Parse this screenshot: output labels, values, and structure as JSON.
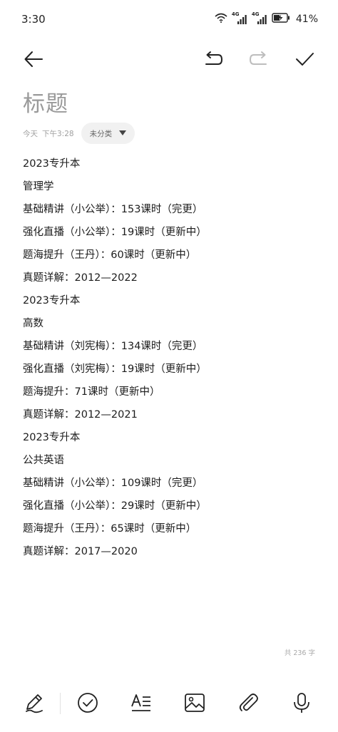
{
  "status_bar": {
    "time": "3:30",
    "network_1": "4G",
    "network_2": "4G",
    "battery_percent": "41%"
  },
  "toolbar": {
    "back_icon": "arrow-left",
    "undo_icon": "undo",
    "redo_icon": "redo",
    "done_icon": "checkmark"
  },
  "note": {
    "title_placeholder": "标题",
    "date_label": "今天",
    "time_label": "下午3:28",
    "category_label": "未分类",
    "lines": [
      "2023专升本",
      "管理学",
      "基础精讲（小公举）：153课时（完更）",
      "强化直播（小公举）：19课时（更新中）",
      "题海提升（王丹）：60课时（更新中）",
      "真题详解：2012—2022",
      "2023专升本",
      "高数",
      "基础精讲（刘宪梅）：134课时（完更）",
      "强化直播（刘宪梅）：19课时（更新中）",
      "题海提升：71课时（更新中）",
      "真题详解：2012—2021",
      "2023专升本",
      "公共英语",
      "基础精讲（小公举）：109课时（完更）",
      "强化直播（小公举）：29课时（更新中）",
      "题海提升（王丹）：65课时（更新中）",
      "真题详解：2017—2020"
    ],
    "word_count": "共 236 字"
  },
  "bottom_bar": {
    "icons": [
      "pen",
      "checklist",
      "text-format",
      "image",
      "attachment",
      "microphone"
    ]
  },
  "colors": {
    "text": "#1c1c1c",
    "muted": "#9a9a9a",
    "chip_bg": "#f1f1f1",
    "icon": "#222222",
    "icon_disabled": "#bdbdbd"
  }
}
